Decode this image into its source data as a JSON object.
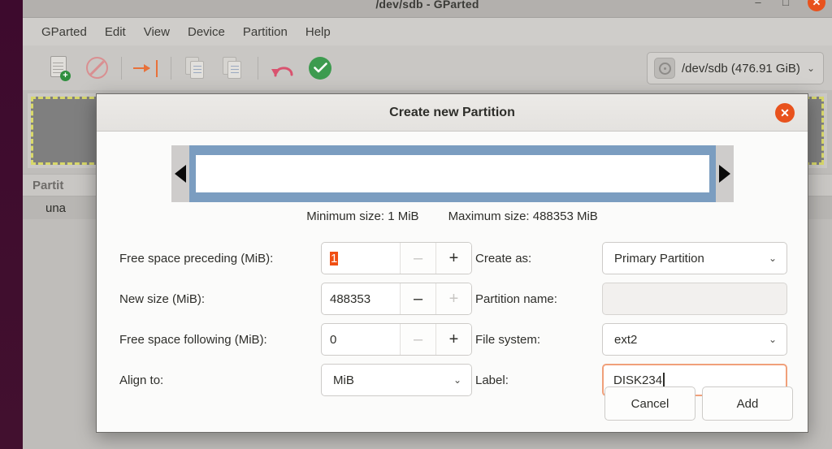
{
  "window": {
    "title": "/dev/sdb - GParted",
    "minimize_label": "–",
    "maximize_label": "□",
    "close_label": "✕"
  },
  "menubar": {
    "items": [
      {
        "label": "GParted"
      },
      {
        "label": "Edit"
      },
      {
        "label": "View"
      },
      {
        "label": "Device"
      },
      {
        "label": "Partition"
      },
      {
        "label": "Help"
      }
    ]
  },
  "toolbar": {
    "buttons": [
      {
        "name": "new-partition",
        "tooltip": "New"
      },
      {
        "name": "delete-partition",
        "tooltip": "Delete"
      },
      {
        "name": "resize-move",
        "tooltip": "Resize/Move"
      },
      {
        "name": "copy",
        "tooltip": "Copy"
      },
      {
        "name": "paste",
        "tooltip": "Paste"
      },
      {
        "name": "undo",
        "tooltip": "Undo"
      },
      {
        "name": "apply",
        "tooltip": "Apply All Operations"
      }
    ],
    "device_selector": {
      "label": "/dev/sdb (476.91 GiB)",
      "caret": "⌄"
    }
  },
  "main": {
    "partition_table_header": "Partit",
    "partition_rows": [
      {
        "name": "una"
      }
    ]
  },
  "dialog": {
    "title": "Create new Partition",
    "close_label": "✕",
    "minimum_size": "Minimum size: 1 MiB",
    "maximum_size": "Maximum size: 488353 MiB",
    "fields": {
      "free_preceding": {
        "label": "Free space preceding (MiB):",
        "value": "1",
        "minus": "–",
        "plus": "+",
        "minus_enabled": false,
        "plus_enabled": true,
        "selected": true
      },
      "new_size": {
        "label": "New size (MiB):",
        "value": "488353",
        "minus": "–",
        "plus": "+",
        "minus_enabled": true,
        "plus_enabled": false
      },
      "free_following": {
        "label": "Free space following (MiB):",
        "value": "0",
        "minus": "–",
        "plus": "+",
        "minus_enabled": false,
        "plus_enabled": true
      },
      "align_to": {
        "label": "Align to:",
        "value": "MiB",
        "caret": "⌄"
      },
      "create_as": {
        "label": "Create as:",
        "value": "Primary Partition",
        "caret": "⌄"
      },
      "partition_name": {
        "label": "Partition name:",
        "value": ""
      },
      "file_system": {
        "label": "File system:",
        "value": "ext2",
        "caret": "⌄"
      },
      "label_field": {
        "label": "Label:",
        "value": "DISK234",
        "focused": true
      }
    },
    "buttons": {
      "cancel": "Cancel",
      "add": "Add"
    }
  },
  "colors": {
    "accent_orange": "#e8521d",
    "selection_orange": "#f04f13",
    "focus_border": "#f0a07a",
    "apply_green": "#3d9b4f",
    "slider_blue": "#7b9dc0",
    "unallocated_gray": "#7f7f7f",
    "selection_dash_yellow": "#d8d86a",
    "launcher_purple": "#3d0a2d"
  }
}
